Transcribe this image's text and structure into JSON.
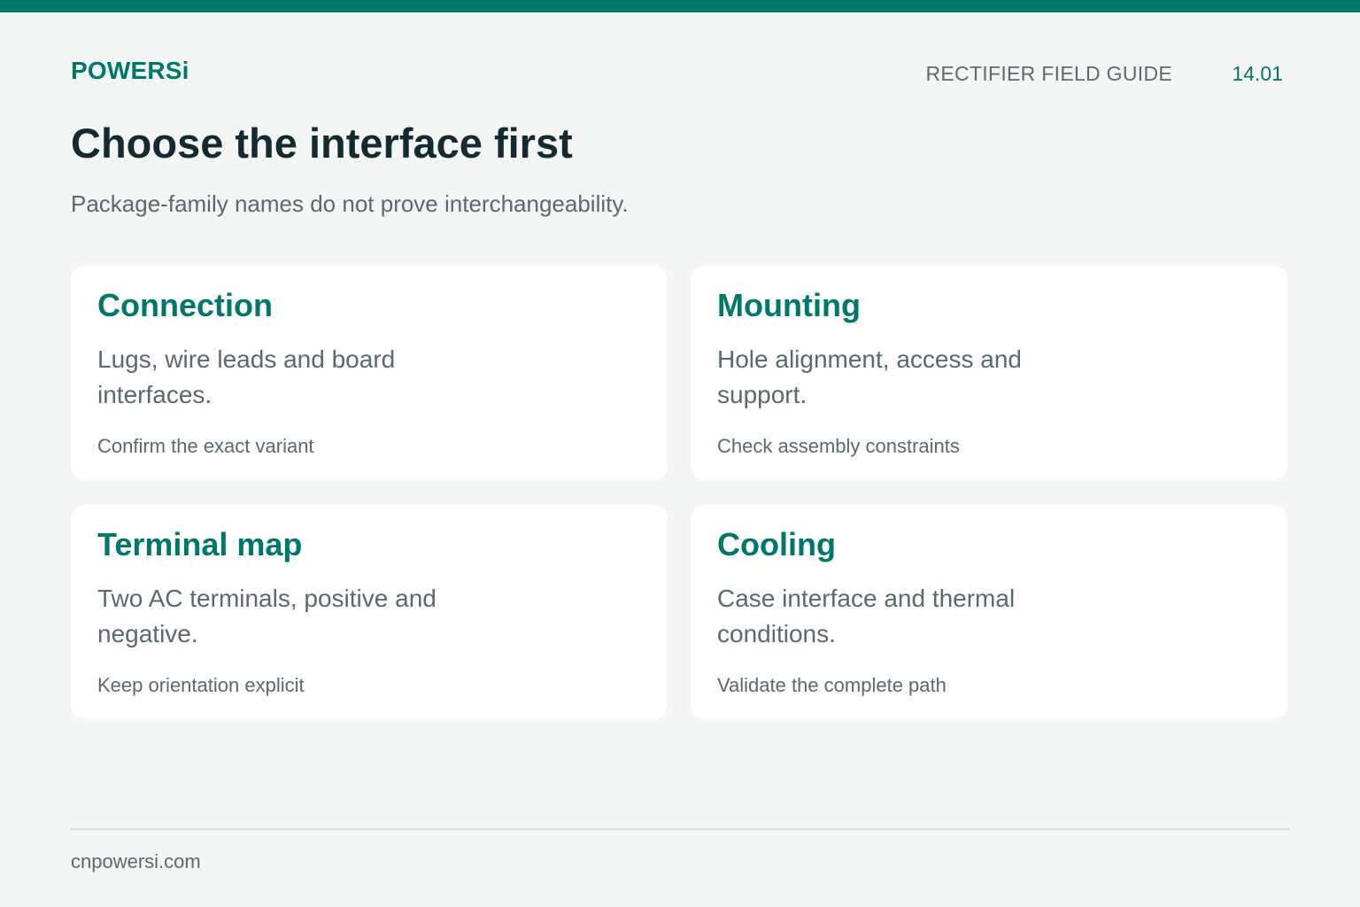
{
  "colors": {
    "accent": "#00776b",
    "background": "#f4f6f5",
    "card": "#ffffff",
    "heading": "#132a33",
    "muted_text": "#5a696e",
    "rule": "#cfe0da"
  },
  "header": {
    "brand": "POWERSi",
    "guide_title": "RECTIFIER FIELD GUIDE",
    "guide_number": "14.01"
  },
  "main": {
    "title": "Choose the interface first",
    "subtitle": "Package-family names do not prove interchangeability.",
    "cards": [
      {
        "title": "Connection",
        "body": "Lugs, wire leads and board interfaces.",
        "note": "Confirm the exact variant"
      },
      {
        "title": "Mounting",
        "body": "Hole alignment, access and support.",
        "note": "Check assembly constraints"
      },
      {
        "title": "Terminal map",
        "body": "Two AC terminals, positive and negative.",
        "note": "Keep orientation explicit"
      },
      {
        "title": "Cooling",
        "body": "Case interface and thermal conditions.",
        "note": "Validate the complete path"
      }
    ]
  },
  "footer": {
    "website": "cnpowersi.com"
  }
}
